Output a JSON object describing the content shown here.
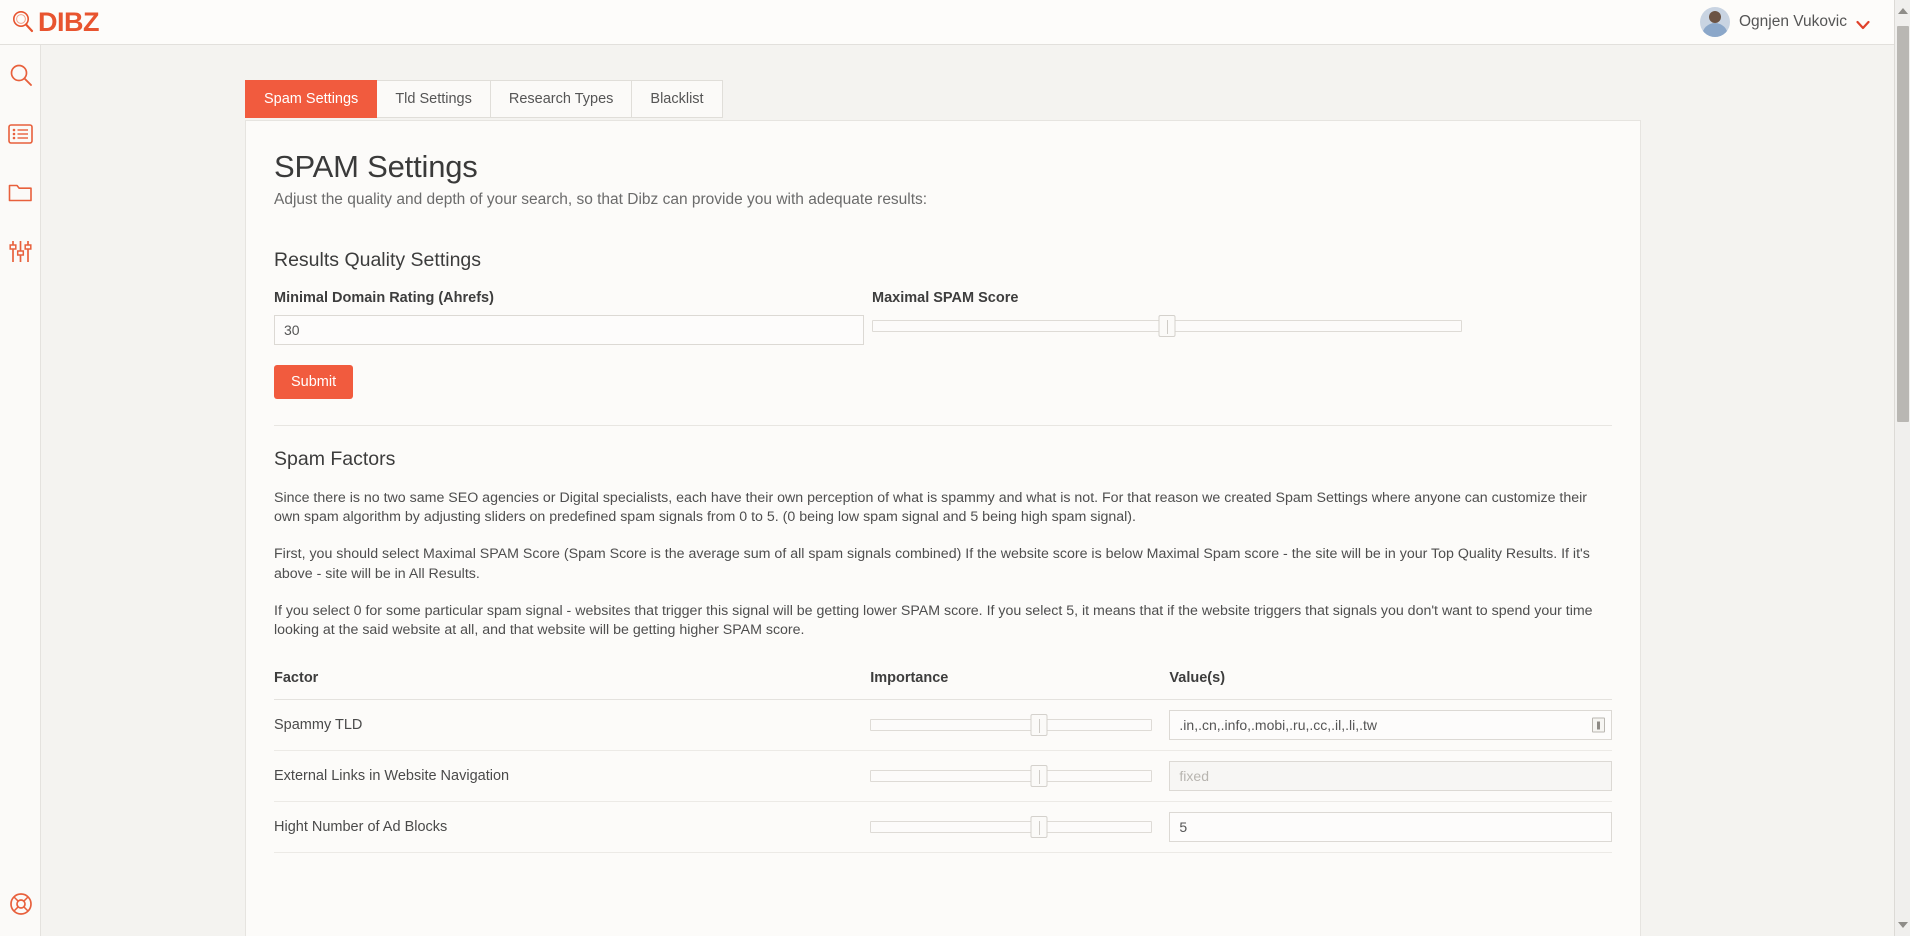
{
  "app": {
    "brand": "DIBZ",
    "brand_color": "#e8542f",
    "accent_color": "#f15b3e"
  },
  "topbar": {
    "user_name": "Ognjen Vukovic",
    "avatar_icon": "user-avatar",
    "dropdown_icon": "chevron-down-icon"
  },
  "sidebar": {
    "items": [
      {
        "icon": "search-icon",
        "name": "search"
      },
      {
        "icon": "list-icon",
        "name": "projects-list"
      },
      {
        "icon": "folder-icon",
        "name": "folders"
      },
      {
        "icon": "sliders-icon",
        "name": "settings"
      }
    ],
    "bottom_item": {
      "icon": "lifebuoy-icon",
      "name": "support"
    }
  },
  "tabs": [
    {
      "label": "Spam Settings",
      "active": true
    },
    {
      "label": "Tld Settings",
      "active": false
    },
    {
      "label": "Research Types",
      "active": false
    },
    {
      "label": "Blacklist",
      "active": false
    }
  ],
  "page": {
    "title": "SPAM Settings",
    "subtitle": "Adjust the quality and depth of your search, so that Dibz can provide you with adequate results:"
  },
  "quality": {
    "section_title": "Results Quality Settings",
    "domain_rating_label": "Minimal Domain Rating (Ahrefs)",
    "domain_rating_value": "30",
    "spam_score_label": "Maximal SPAM Score",
    "spam_score_percent": 50,
    "submit_label": "Submit"
  },
  "spam_factors": {
    "section_title": "Spam Factors",
    "paragraphs": [
      "Since there is no two same SEO agencies or Digital specialists, each have their own perception of what is spammy and what is not. For that reason we created Spam Settings where anyone can customize their own spam algorithm by adjusting sliders on predefined spam signals from 0 to 5. (0 being low spam signal and 5 being high spam signal).",
      "First, you should select Maximal SPAM Score (Spam Score is the average sum of all spam signals combined) If the website score is below Maximal Spam score - the site will be in your Top Quality Results. If it's above - site will be in All Results.",
      "If you select 0 for some particular spam signal - websites that trigger this signal will be getting lower SPAM score. If you select 5, it means that if the website triggers that signals you don't want to spend your time looking at the said website at all, and that website will be getting higher SPAM score."
    ],
    "columns": [
      "Factor",
      "Importance",
      "Value(s)"
    ],
    "rows": [
      {
        "factor": "Spammy TLD",
        "importance_percent": 60,
        "value": ".in,.cn,.info,.mobi,.ru,.cc,.il,.li,.tw",
        "placeholder": "",
        "disabled": false,
        "has_icon": true,
        "icon": "edit-field-icon"
      },
      {
        "factor": "External Links in Website Navigation",
        "importance_percent": 60,
        "value": "",
        "placeholder": "fixed",
        "disabled": true,
        "has_icon": false,
        "icon": ""
      },
      {
        "factor": "Hight Number of Ad Blocks",
        "importance_percent": 60,
        "value": "5",
        "placeholder": "",
        "disabled": false,
        "has_icon": false,
        "icon": ""
      }
    ]
  }
}
